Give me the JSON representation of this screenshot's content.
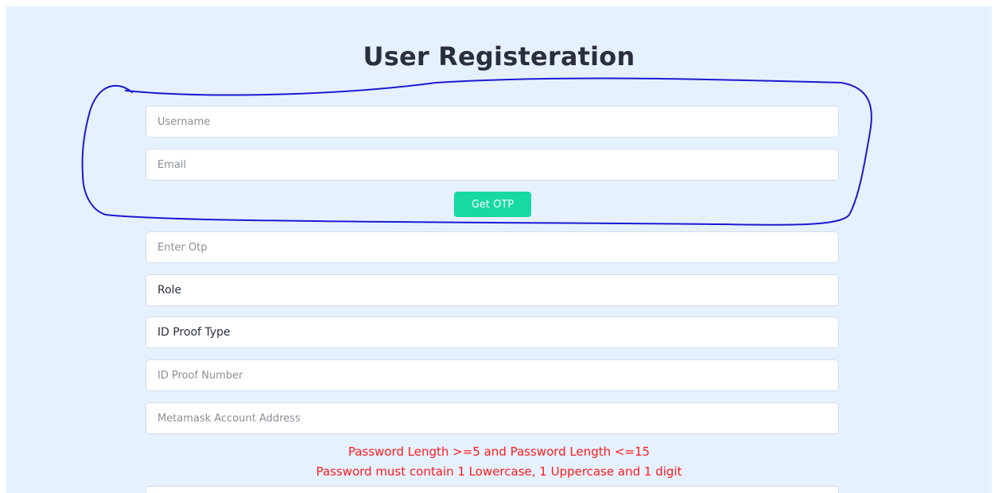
{
  "page": {
    "title": "User Registeration"
  },
  "form": {
    "username": {
      "placeholder": "Username",
      "value": ""
    },
    "email": {
      "placeholder": "Email",
      "value": ""
    },
    "get_otp_label": "Get OTP",
    "otp": {
      "placeholder": "Enter Otp",
      "value": ""
    },
    "role": {
      "selected": "Role"
    },
    "id_proof_type": {
      "selected": "ID Proof Type"
    },
    "id_proof_number": {
      "placeholder": "ID Proof Number",
      "value": ""
    },
    "metamask_address": {
      "placeholder": "Metamask Account Address",
      "value": ""
    }
  },
  "password_rules": {
    "length_rule": "Password Length >=5 and Password Length <=15",
    "composition_rule": "Password must contain 1 Lowercase, 1 Uppercase and 1 digit"
  },
  "colors": {
    "background": "#e6f1ff",
    "primary_button": "#16d9a4",
    "error_text": "#ff1a1a",
    "annotation_ink": "#1a1ad0"
  }
}
